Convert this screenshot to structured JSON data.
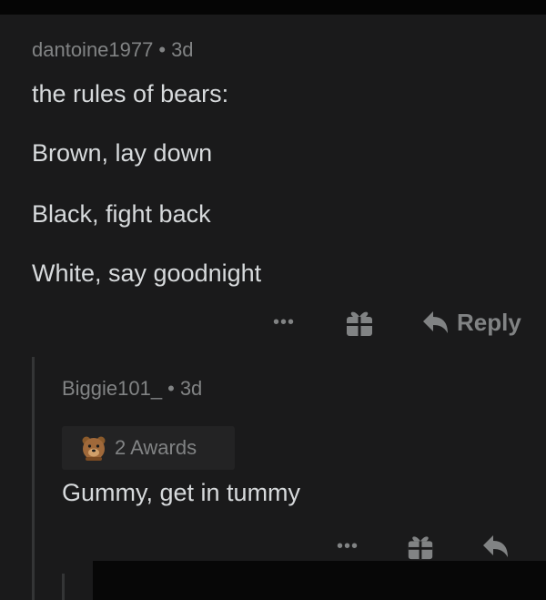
{
  "parent_comment": {
    "username": "dantoine1977",
    "separator": "•",
    "age": "3d",
    "lines": [
      "the rules of bears:",
      "Brown, lay down",
      "Black, fight back",
      "White, say goodnight"
    ]
  },
  "parent_actions": {
    "more": "•••",
    "reply_label": "Reply"
  },
  "reply_comment": {
    "username": "Biggie101_",
    "separator": "•",
    "age": "3d",
    "awards_label": "2 Awards",
    "text": "Gummy, get in tummy"
  },
  "reply_actions": {
    "more": "•••"
  },
  "icons": [
    "gift-icon",
    "reply-arrow-icon",
    "more-dots-icon",
    "award-bear-icon"
  ],
  "colors": {
    "background": "#1a1a1b",
    "text": "#d7dadc",
    "muted": "#818384",
    "thread_line": "#343536"
  }
}
